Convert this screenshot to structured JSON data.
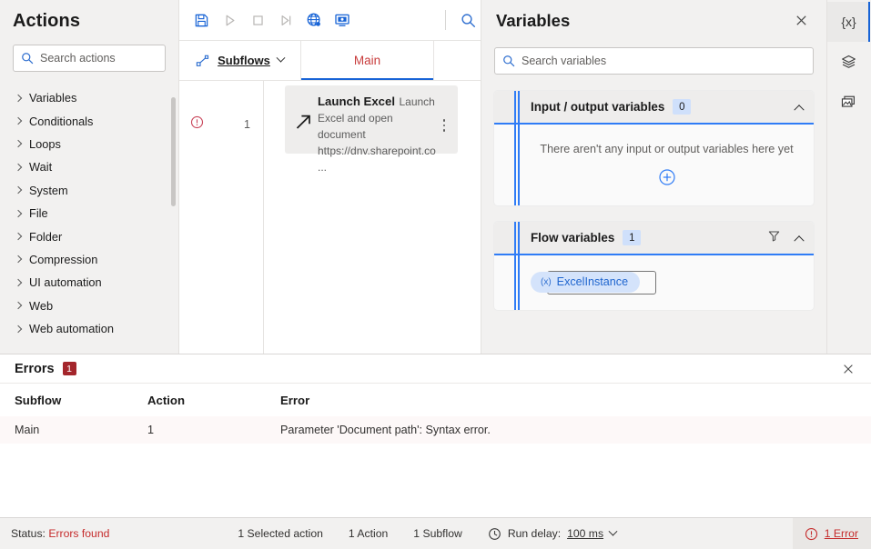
{
  "actions_panel": {
    "title": "Actions",
    "search_placeholder": "Search actions",
    "groups": [
      {
        "label": "Variables"
      },
      {
        "label": "Conditionals"
      },
      {
        "label": "Loops"
      },
      {
        "label": "Wait"
      },
      {
        "label": "System"
      },
      {
        "label": "File"
      },
      {
        "label": "Folder"
      },
      {
        "label": "Compression"
      },
      {
        "label": "UI automation"
      },
      {
        "label": "Web"
      },
      {
        "label": "Web automation"
      }
    ]
  },
  "toolbar": {
    "save": "save-icon",
    "run": "run-icon",
    "stop": "stop-icon",
    "run_next": "run-next-action-icon",
    "web_recorder": "web-recorder-icon",
    "desktop_recorder": "desktop-recorder-icon",
    "search": "search-icon"
  },
  "tabs": {
    "subflows_label": "Subflows",
    "main_label": "Main",
    "main_is_error": true,
    "main_color": "#c83c3c",
    "active_underline_color": "#1763d6"
  },
  "canvas": {
    "rows": [
      {
        "number": "1",
        "has_error": true,
        "title": "Launch Excel",
        "description": "Launch Excel and open document https://dnv.sharepoint.co...",
        "selected": true
      }
    ]
  },
  "variables_panel": {
    "title": "Variables",
    "search_placeholder": "Search variables",
    "sections": [
      {
        "title": "Input / output variables",
        "count": "0",
        "empty_message": "There aren't any input or output variables here yet",
        "has_add": true,
        "has_filter": false,
        "expanded": true
      },
      {
        "title": "Flow variables",
        "count": "1",
        "has_filter": true,
        "expanded": true,
        "variables": [
          {
            "name": "ExcelInstance",
            "type_glyph": "(x)"
          }
        ]
      }
    ]
  },
  "right_rail": {
    "items": [
      {
        "icon": "variables-icon",
        "glyph": "{x}",
        "selected": true
      },
      {
        "icon": "ui-elements-icon",
        "glyph": "layers",
        "selected": false
      },
      {
        "icon": "images-icon",
        "glyph": "image",
        "selected": false
      }
    ]
  },
  "errors_panel": {
    "title": "Errors",
    "count": "1",
    "columns": {
      "subflow": "Subflow",
      "action": "Action",
      "error": "Error"
    },
    "rows": [
      {
        "subflow": "Main",
        "action": "1",
        "error": "Parameter 'Document path': Syntax error."
      }
    ]
  },
  "status_bar": {
    "status_label": "Status:",
    "status_value": "Errors found",
    "selected_actions": "1 Selected action",
    "actions_count": "1 Action",
    "subflows_count": "1 Subflow",
    "run_delay_label": "Run delay:",
    "run_delay_value": "100 ms",
    "error_count": "1 Error"
  },
  "colors": {
    "accent_blue": "#1763d6",
    "error_red": "#c52b2b",
    "badge_red": "#a4262c",
    "panel_bg": "#f2f1f0",
    "pill_blue_bg": "#d4e3fb",
    "pill_blue_text": "#2066cf"
  }
}
